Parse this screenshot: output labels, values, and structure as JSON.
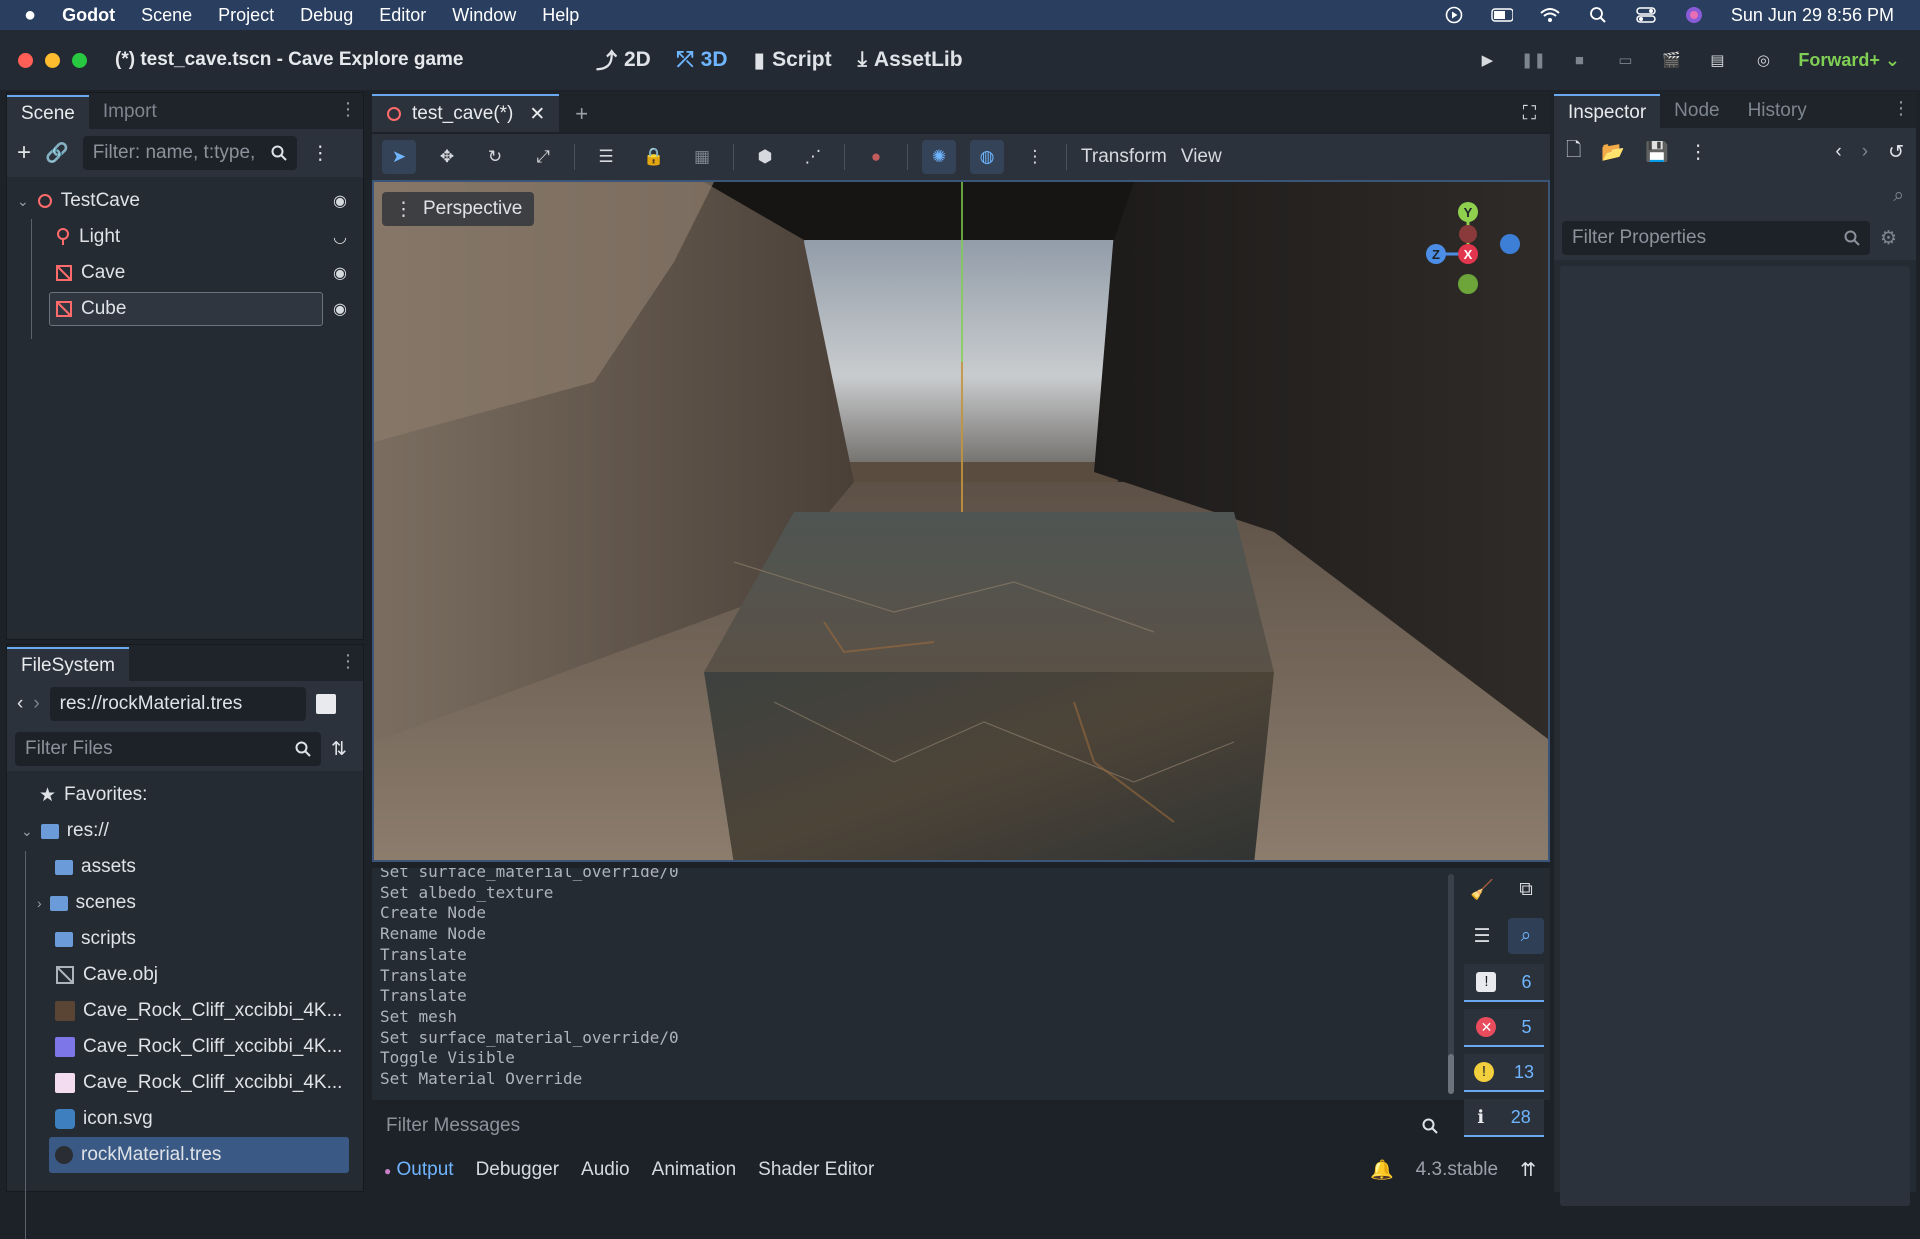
{
  "macbar": {
    "app": "Godot",
    "menus": [
      "Scene",
      "Project",
      "Debug",
      "Editor",
      "Window",
      "Help"
    ],
    "clock": "Sun Jun 29  8:56 PM"
  },
  "window": {
    "title": "(*) test_cave.tscn - Cave Explore game",
    "modes": {
      "m2d": "2D",
      "m3d": "3D",
      "script": "Script",
      "assetlib": "AssetLib"
    },
    "renderer": "Forward+"
  },
  "scene_dock": {
    "tabs": {
      "scene": "Scene",
      "import": "Import"
    },
    "filter_placeholder": "Filter: name, t:type,",
    "nodes": {
      "root": "TestCave",
      "light": "Light",
      "cave": "Cave",
      "cube": "Cube"
    }
  },
  "filesystem": {
    "tab": "FileSystem",
    "path": "res://rockMaterial.tres",
    "filter_placeholder": "Filter Files",
    "favorites": "Favorites:",
    "root": "res://",
    "items": {
      "assets": "assets",
      "scenes": "scenes",
      "scripts": "scripts",
      "cave_obj": "Cave.obj",
      "rock1": "Cave_Rock_Cliff_xccibbi_4K...",
      "rock2": "Cave_Rock_Cliff_xccibbi_4K...",
      "rock3": "Cave_Rock_Cliff_xccibbi_4K...",
      "icon": "icon.svg",
      "material": "rockMaterial.tres"
    }
  },
  "editor": {
    "tab": "test_cave(*)",
    "menu_transform": "Transform",
    "menu_view": "View",
    "perspective": "Perspective",
    "gizmo": {
      "y": "Y",
      "z": "Z",
      "x": "X"
    }
  },
  "console": {
    "lines": [
      "Set surface_material_override/0",
      "Set albedo_texture",
      "Create Node",
      "Rename Node",
      "Translate",
      "Translate",
      "Translate",
      "Set mesh",
      "Set surface_material_override/0",
      "Toggle Visible",
      "Set Material Override"
    ],
    "filter_placeholder": "Filter Messages",
    "counts": {
      "messages": "6",
      "errors": "5",
      "warnings": "13",
      "editor": "28"
    },
    "tabs": {
      "output": "Output",
      "debugger": "Debugger",
      "audio": "Audio",
      "animation": "Animation",
      "shader": "Shader Editor"
    },
    "version": "4.3.stable"
  },
  "inspector": {
    "tabs": {
      "inspector": "Inspector",
      "node": "Node",
      "history": "History"
    },
    "filter_placeholder": "Filter Properties"
  },
  "colors": {
    "accent": "#6fb5ff",
    "renderer": "#7fcf55",
    "node_icon": "#ff6b6b"
  }
}
